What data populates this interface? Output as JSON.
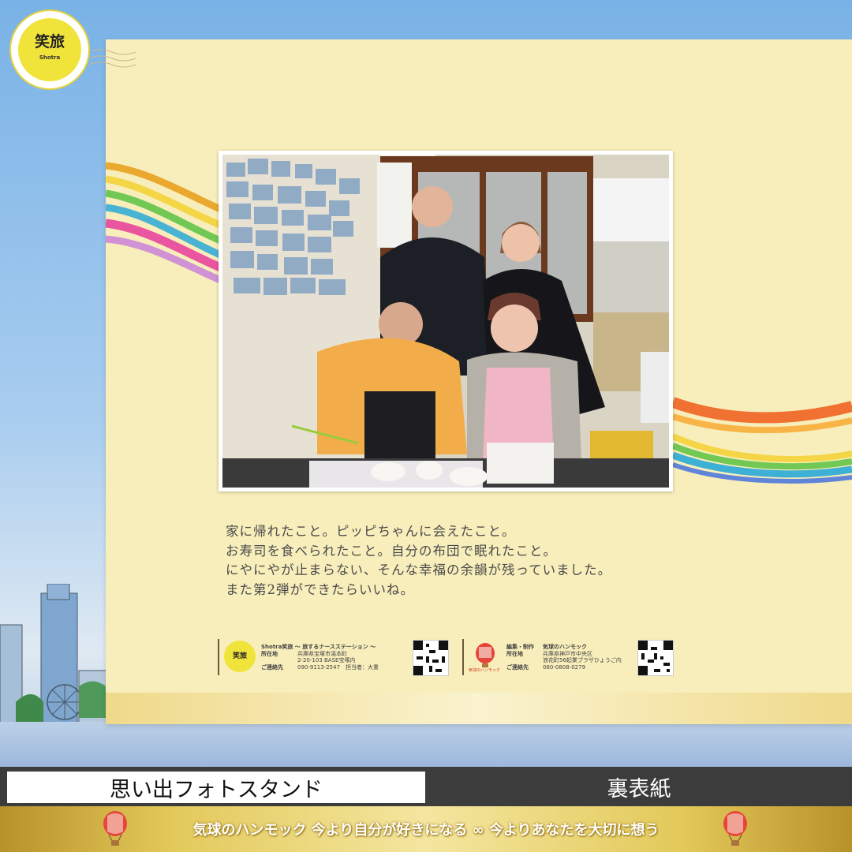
{
  "logo": {
    "text": "笑旅",
    "sub": "Shotra"
  },
  "message_lines": [
    "家に帰れたこと。ピッピちゃんに会えたこと。",
    "お寿司を食べられたこと。自分の布団で眠れたこと。",
    "にやにやが止まらない、そんな幸福の余韻が残っていました。",
    "また第2弾ができたらいいね。"
  ],
  "footer_left": {
    "logo_text": "笑旅",
    "org": "Shotra笑旅 〜 旅するナースステーション 〜",
    "location_label": "所在地",
    "location_1": "兵庫県宝塚市湯本町",
    "location_2": "2-20-103 BASE宝塚内",
    "contact_label": "ご連絡先",
    "contact": "090-9113-2547　担当者：大重"
  },
  "footer_right": {
    "edit_label": "編集・制作",
    "edit": "気球のハンモック",
    "location_label": "所在地",
    "location_1": "兵庫県神戸市中央区",
    "location_2": "浪花町56起業プラザひょうご内",
    "contact_label": "ご連絡先",
    "contact": "080-0808-0279",
    "logo_caption": "気球のハンモック"
  },
  "bottom_bar": {
    "title": "思い出フォトスタンド",
    "side_label": "裏表紙"
  },
  "tagline": "気球のハンモック 今より自分が好きになる ∞ 今よりあなたを大切に想う",
  "colors": {
    "card": "#f8eebb",
    "accent_gold": "#e3c95a",
    "bar": "#3c3c3c"
  }
}
